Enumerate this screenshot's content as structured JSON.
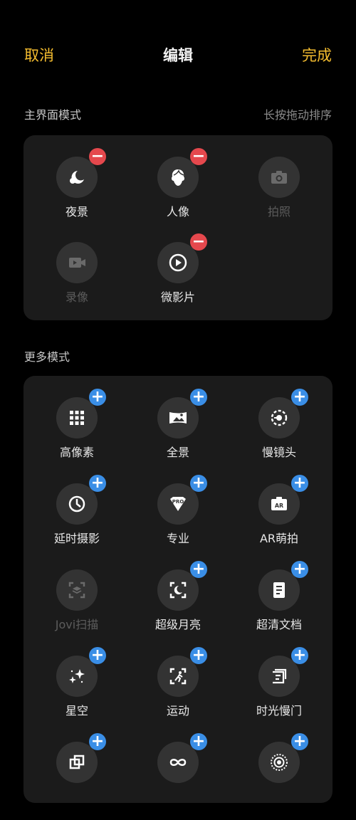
{
  "header": {
    "cancel": "取消",
    "title": "编辑",
    "done": "完成"
  },
  "main_modes": {
    "title": "主界面模式",
    "hint": "长按拖动排序",
    "items": [
      {
        "label": "夜景",
        "icon": "night-icon",
        "removable": true
      },
      {
        "label": "人像",
        "icon": "portrait-icon",
        "removable": true
      },
      {
        "label": "拍照",
        "icon": "camera-icon",
        "removable": false
      },
      {
        "label": "录像",
        "icon": "video-icon",
        "removable": false
      },
      {
        "label": "微影片",
        "icon": "movie-icon",
        "removable": true
      }
    ]
  },
  "more_modes": {
    "title": "更多模式",
    "items": [
      {
        "label": "高像素",
        "icon": "grid-icon"
      },
      {
        "label": "全景",
        "icon": "panorama-icon"
      },
      {
        "label": "慢镜头",
        "icon": "slowmo-icon"
      },
      {
        "label": "延时摄影",
        "icon": "timelapse-icon"
      },
      {
        "label": "专业",
        "icon": "pro-icon"
      },
      {
        "label": "AR萌拍",
        "icon": "ar-icon"
      },
      {
        "label": "Jovi扫描",
        "icon": "scan-icon"
      },
      {
        "label": "超级月亮",
        "icon": "moon-icon"
      },
      {
        "label": "超清文档",
        "icon": "document-icon"
      },
      {
        "label": "星空",
        "icon": "starry-icon"
      },
      {
        "label": "运动",
        "icon": "sport-icon"
      },
      {
        "label": "时光慢门",
        "icon": "slow-shutter-icon"
      },
      {
        "label": "",
        "icon": "double-exposure-icon"
      },
      {
        "label": "",
        "icon": "infinity-icon"
      },
      {
        "label": "",
        "icon": "circle-target-icon"
      }
    ]
  },
  "colors": {
    "accent": "#f5bd2f",
    "minus": "#e5484d",
    "plus": "#3a8ee6"
  }
}
